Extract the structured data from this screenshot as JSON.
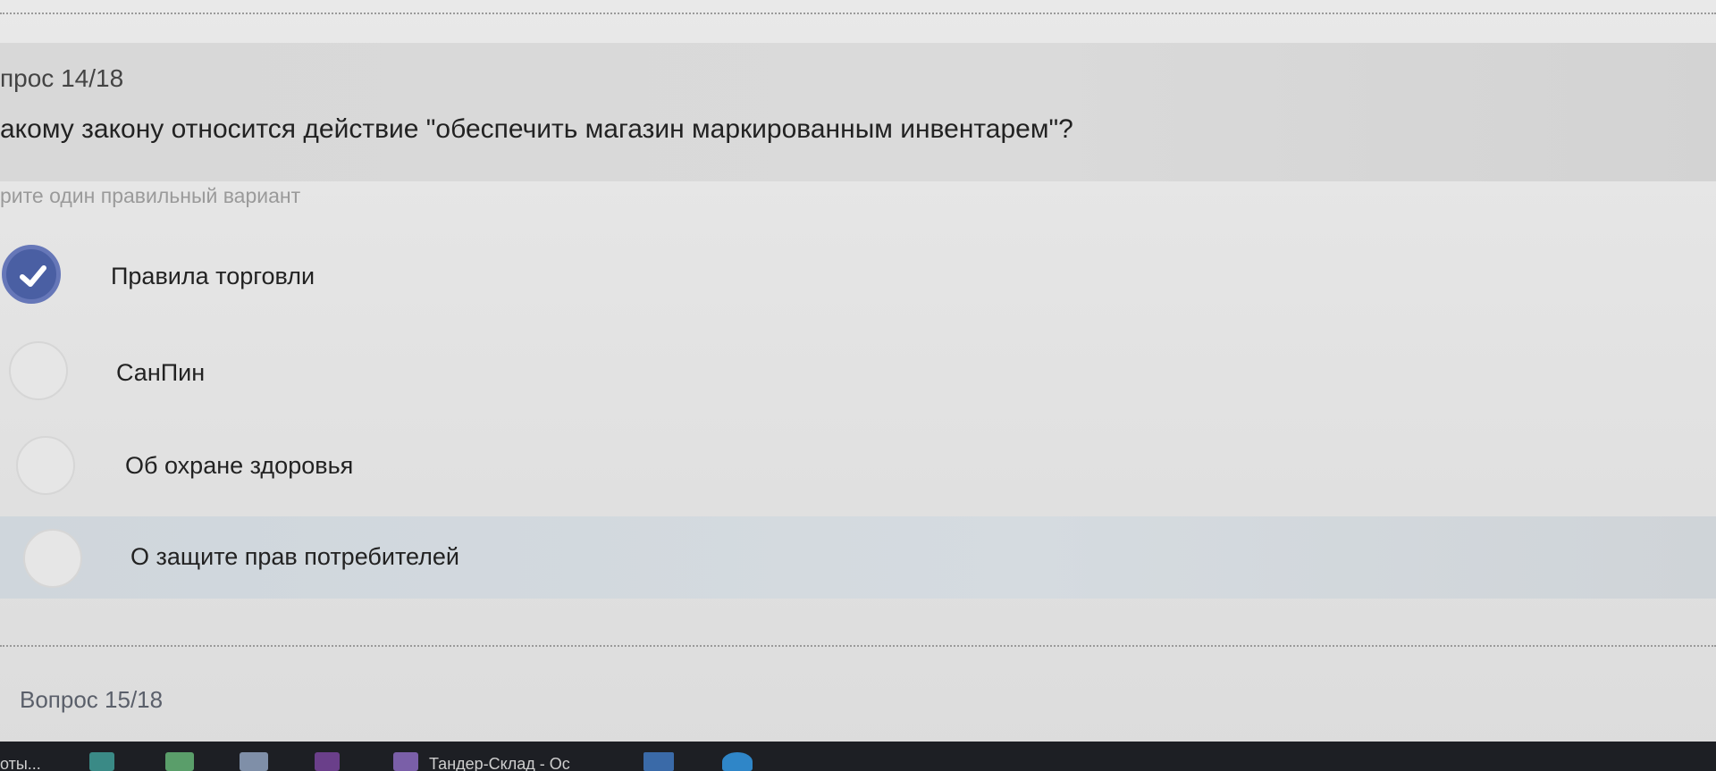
{
  "question": {
    "number": "прос 14/18",
    "text": "акому закону относится действие \"обеспечить магазин маркированным инвентарем\"?",
    "instruction": "рите один правильный вариант"
  },
  "options": [
    {
      "label": "Правила торговли",
      "selected": true
    },
    {
      "label": "СанПин",
      "selected": false
    },
    {
      "label": "Об охране здоровья",
      "selected": false
    },
    {
      "label": "О защите прав потребителей",
      "selected": false,
      "hovered": true
    }
  ],
  "next_question": {
    "number": "Вопрос 15/18"
  },
  "taskbar": {
    "left_text": "оты...",
    "window_title": "Тандер-Склад - Ос"
  },
  "colors": {
    "accent": "#4a5fa3",
    "highlight_row": "#d3d9de",
    "taskbar": "#1d1f24"
  }
}
